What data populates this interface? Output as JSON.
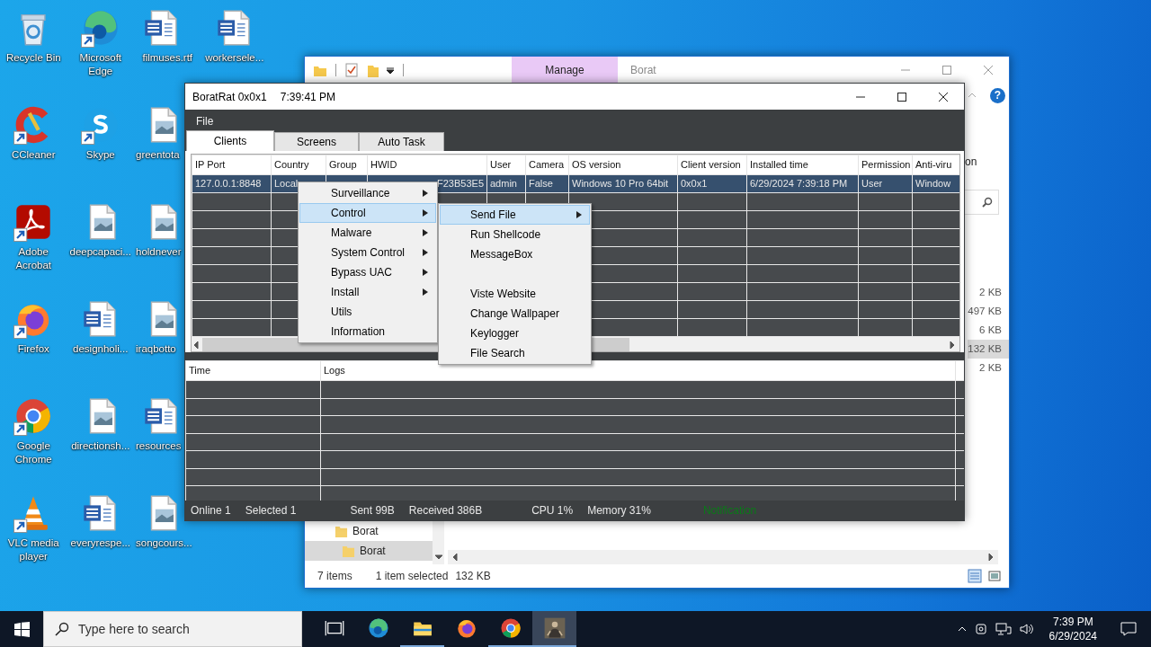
{
  "desktop_columns": [
    [
      {
        "label": "Recycle Bin",
        "kind": "recycle",
        "shortcut": false
      },
      {
        "label": "CCleaner",
        "kind": "ccleaner",
        "shortcut": true
      },
      {
        "label": "Adobe Acrobat",
        "kind": "acrobat",
        "shortcut": true
      },
      {
        "label": "Firefox",
        "kind": "firefox",
        "shortcut": true
      },
      {
        "label": "Google Chrome",
        "kind": "chrome",
        "shortcut": true
      },
      {
        "label": "VLC media player",
        "kind": "vlc",
        "shortcut": true
      }
    ],
    [
      {
        "label": "Microsoft Edge",
        "kind": "edge",
        "shortcut": true
      },
      {
        "label": "Skype",
        "kind": "skype",
        "shortcut": true
      },
      {
        "label": "deepcapaci...",
        "kind": "image",
        "shortcut": false
      },
      {
        "label": "designholi...",
        "kind": "word",
        "shortcut": false
      },
      {
        "label": "directionsh...",
        "kind": "image",
        "shortcut": false
      },
      {
        "label": "everyrespe...",
        "kind": "word",
        "shortcut": false
      }
    ],
    [
      {
        "label": "filmuses.rtf",
        "kind": "word",
        "shortcut": false
      },
      {
        "label": "greentota",
        "kind": "image",
        "shortcut": false
      },
      {
        "label": "holdnever",
        "kind": "image",
        "shortcut": false
      },
      {
        "label": "iraqbotto",
        "kind": "image",
        "shortcut": false
      },
      {
        "label": "resources",
        "kind": "word",
        "shortcut": false
      },
      {
        "label": "songcours...",
        "kind": "image",
        "shortcut": false
      }
    ],
    [
      {
        "label": "workersele...",
        "kind": "word",
        "shortcut": false
      }
    ]
  ],
  "explorer": {
    "ribbon_tab": {
      "label": "Manage",
      "selected": true
    },
    "title": "Borat",
    "help_label": "?",
    "partial_label": "on",
    "sizes": [
      {
        "text": "2 KB",
        "selected": false
      },
      {
        "text": "497 KB",
        "selected": false
      },
      {
        "text": "6 KB",
        "selected": false
      },
      {
        "text": "132 KB",
        "selected": true
      },
      {
        "text": "2 KB",
        "selected": false
      }
    ],
    "tree": [
      {
        "label": "Borat",
        "selected": false,
        "children": [
          {
            "label": "Borat",
            "selected": true
          }
        ]
      }
    ],
    "status": {
      "items": "7 items",
      "selection": "1 item selected",
      "size": "132 KB"
    }
  },
  "app": {
    "title": "BoratRat 0x0x1",
    "time": "7:39:41 PM",
    "menu": [
      "File"
    ],
    "tabs": [
      {
        "label": "Clients",
        "selected": true
      },
      {
        "label": "Screens",
        "selected": false
      },
      {
        "label": "Auto Task",
        "selected": false
      }
    ],
    "clients": {
      "columns": [
        "IP Port",
        "Country",
        "Group",
        "HWID",
        "User",
        "Camera",
        "OS version",
        "Client version",
        "Installed time",
        "Permission",
        "Anti-viru"
      ],
      "rows": [
        {
          "selected": true,
          "cells": [
            "127.0.0.1:8848",
            "Local",
            null,
            "F23B53E5",
            "admin",
            "False",
            "Windows 10 Pro 64bit",
            "0x0x1",
            "6/29/2024 7:39:18 PM",
            "User",
            "Window"
          ]
        }
      ]
    },
    "logs": {
      "columns": [
        "Time",
        "Logs"
      ]
    },
    "status_bar": [
      {
        "text": "Online 1",
        "kind": "info"
      },
      {
        "text": "Selected 1",
        "kind": "info"
      },
      {
        "text": "Sent 99B",
        "kind": "info"
      },
      {
        "text": "Received 386B",
        "kind": "info"
      },
      {
        "text": "CPU 1%",
        "kind": "info"
      },
      {
        "text": "Memory 31%",
        "kind": "info"
      },
      {
        "text": "Notification",
        "kind": "notice"
      }
    ]
  },
  "context_menu": {
    "items": [
      {
        "label": "Surveillance",
        "submenu": true,
        "selected": false
      },
      {
        "label": "Control",
        "submenu": true,
        "selected": true
      },
      {
        "label": "Malware",
        "submenu": true,
        "selected": false
      },
      {
        "label": "System Control",
        "submenu": true,
        "selected": false
      },
      {
        "label": "Bypass UAC",
        "submenu": true,
        "selected": false
      },
      {
        "label": "Install",
        "submenu": true,
        "selected": false
      },
      {
        "label": "Utils",
        "submenu": false,
        "selected": false
      },
      {
        "label": "Information",
        "submenu": false,
        "selected": false
      }
    ]
  },
  "submenu": {
    "items": [
      {
        "kind": "item",
        "label": "Send File",
        "submenu": true,
        "selected": true
      },
      {
        "kind": "item",
        "label": "Run Shellcode",
        "submenu": false,
        "selected": false
      },
      {
        "kind": "item",
        "label": "MessageBox",
        "submenu": false,
        "selected": false
      },
      {
        "kind": "gap"
      },
      {
        "kind": "item",
        "label": "Viste Website",
        "submenu": false,
        "selected": false
      },
      {
        "kind": "item",
        "label": "Change Wallpaper",
        "submenu": false,
        "selected": false
      },
      {
        "kind": "item",
        "label": "Keylogger",
        "submenu": false,
        "selected": false
      },
      {
        "kind": "item",
        "label": "File Search",
        "submenu": false,
        "selected": false
      }
    ]
  },
  "taskbar": {
    "search": {
      "placeholder": "Type here to search"
    },
    "apps": [
      {
        "kind": "taskview",
        "running": false,
        "active": false
      },
      {
        "kind": "edge",
        "running": false,
        "active": false
      },
      {
        "kind": "explorer",
        "running": true,
        "active": false
      },
      {
        "kind": "firefox",
        "running": false,
        "active": false
      },
      {
        "kind": "chrome",
        "running": true,
        "active": false
      },
      {
        "kind": "app",
        "running": true,
        "active": true
      }
    ],
    "clock": {
      "time": "7:39 PM",
      "date": "6/29/2024"
    }
  }
}
